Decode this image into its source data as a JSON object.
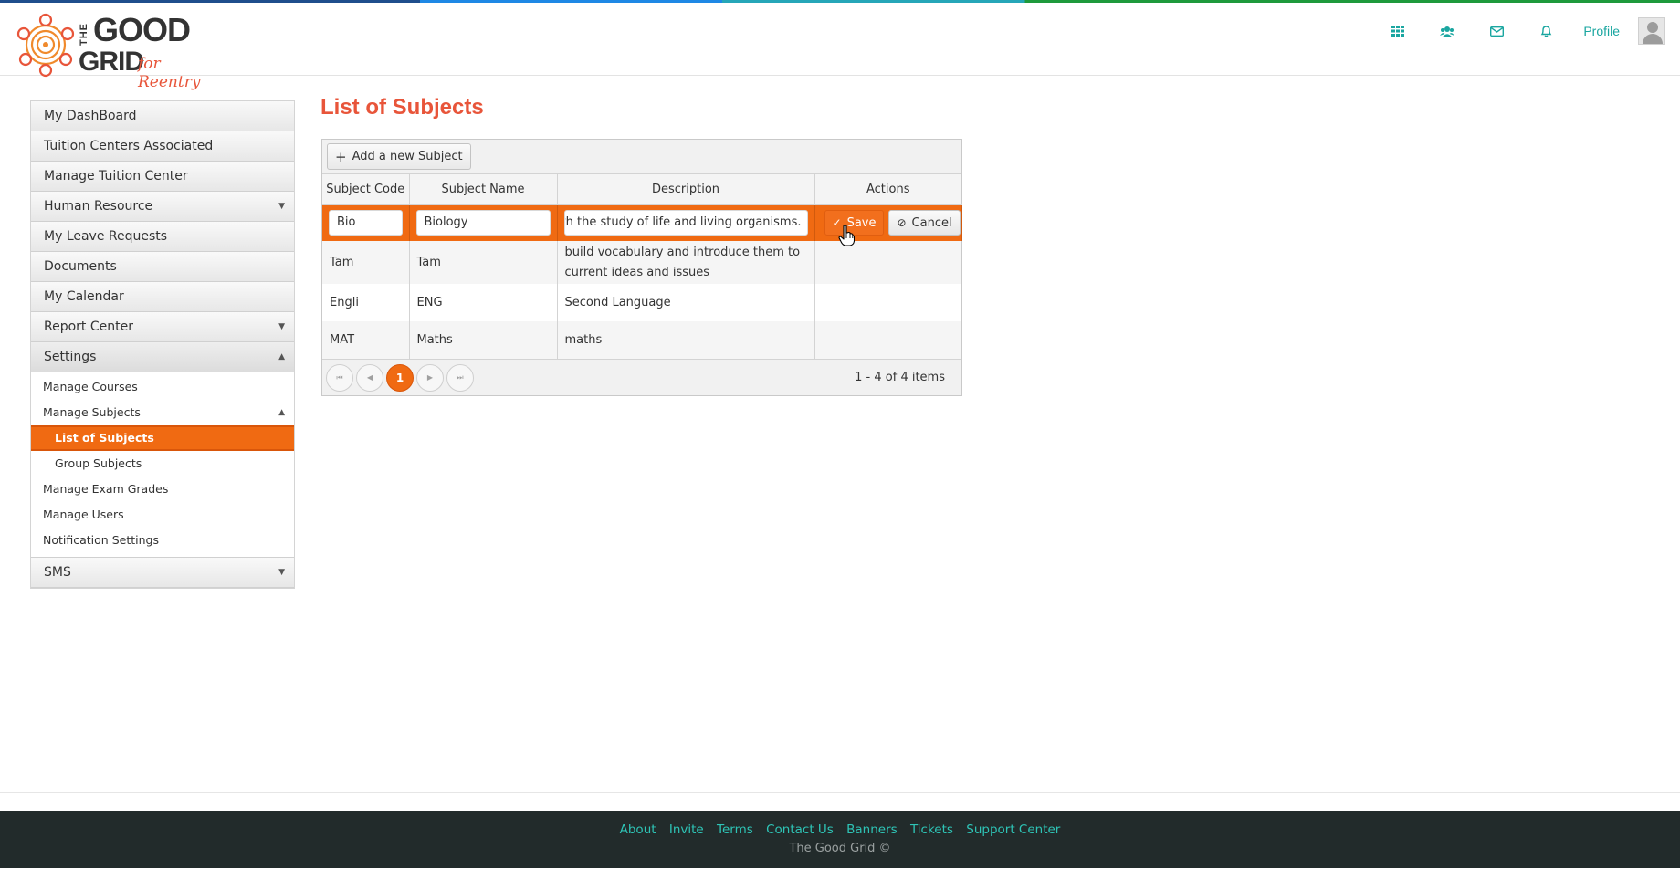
{
  "brand": {
    "the": "THE",
    "good": "GOOD",
    "grid": "GRID",
    "tagline": "for Reentry",
    "accent": "#e8553a"
  },
  "nav": {
    "icons": [
      "apps-grid-icon",
      "users-icon",
      "mail-icon",
      "bell-icon"
    ],
    "profile_label": "Profile"
  },
  "sidebar": {
    "items": [
      {
        "label": "My DashBoard"
      },
      {
        "label": "Tuition Centers Associated"
      },
      {
        "label": "Manage Tuition Center"
      },
      {
        "label": "Human Resource",
        "caret": "▼"
      },
      {
        "label": "My Leave Requests"
      },
      {
        "label": "Documents"
      },
      {
        "label": "My Calendar"
      },
      {
        "label": "Report Center",
        "caret": "▼"
      },
      {
        "label": "Settings",
        "caret": "▲"
      }
    ],
    "settings_sub": [
      {
        "label": "Manage Courses"
      },
      {
        "label": "Manage Subjects",
        "caret": "▲"
      },
      {
        "label": "List of Subjects"
      },
      {
        "label": "Group Subjects"
      },
      {
        "label": "Manage Exam Grades"
      },
      {
        "label": "Manage Users"
      },
      {
        "label": "Notification Settings"
      }
    ],
    "last": {
      "label": "SMS",
      "caret": "▼"
    }
  },
  "main": {
    "title": "List of Subjects",
    "add_button": "Add a new Subject",
    "columns": [
      "Subject Code",
      "Subject Name",
      "Description",
      "Actions"
    ],
    "edit_row": {
      "code": "Bio",
      "name": "Biology",
      "description": "d with the study of life and living organisms.",
      "save": "Save",
      "cancel": "Cancel"
    },
    "rows": [
      {
        "code": "Tam",
        "name": "Tam",
        "description": "build vocabulary and introduce them to current ideas and issues"
      },
      {
        "code": "Engli",
        "name": "ENG",
        "description": "Second Language"
      },
      {
        "code": "MAT",
        "name": "Maths",
        "description": "maths"
      }
    ],
    "pager": {
      "first": "⏮",
      "prev": "◀",
      "current": "1",
      "next": "▶",
      "last": "⏭",
      "info": "1 - 4 of 4 items"
    }
  },
  "footer": {
    "links": [
      "About",
      "Invite",
      "Terms",
      "Contact Us",
      "Banners",
      "Tickets",
      "Support Center"
    ],
    "copyright": "The Good Grid ©"
  }
}
